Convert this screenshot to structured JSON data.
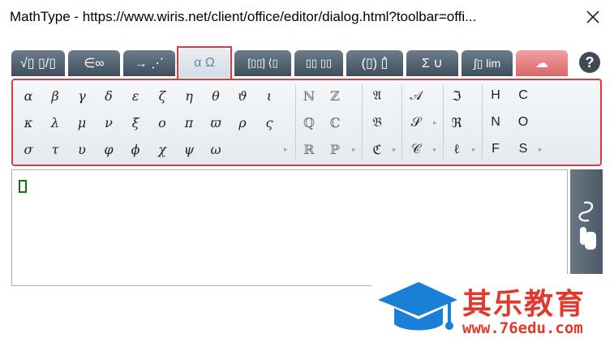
{
  "window": {
    "title": "MathType - https://www.wiris.net/client/office/editor/dialog.html?toolbar=offi..."
  },
  "tabs": [
    {
      "label": "√▯ ▯/▯",
      "name": "general"
    },
    {
      "label": "∈∞",
      "name": "symbols"
    },
    {
      "label": "→ ⋰",
      "name": "arrows"
    },
    {
      "label": "α Ω",
      "name": "greek",
      "active": true
    },
    {
      "label": "[▯▯] ⟨▯",
      "name": "matrices"
    },
    {
      "label": "▯▯ ▯▯",
      "name": "scripts"
    },
    {
      "label": "(▯) ▯̂",
      "name": "brackets"
    },
    {
      "label": "Σ ∪",
      "name": "big-operators"
    },
    {
      "label": "∫▯ lim",
      "name": "calculus"
    },
    {
      "label": "☁",
      "name": "contextual"
    }
  ],
  "help_label": "?",
  "palette": {
    "greek_rows": [
      [
        "α",
        "β",
        "γ",
        "δ",
        "ε",
        "ζ",
        "η",
        "θ",
        "ϑ",
        "ι"
      ],
      [
        "κ",
        "λ",
        "μ",
        "ν",
        "ξ",
        "ο",
        "π",
        "ϖ",
        "ρ",
        "ς"
      ],
      [
        "σ",
        "τ",
        "υ",
        "φ",
        "ϕ",
        "χ",
        "ψ",
        "ω"
      ]
    ],
    "doublestruck": [
      [
        "ℕ",
        "ℤ"
      ],
      [
        "ℚ",
        "ℂ"
      ],
      [
        "ℝ",
        "ℙ"
      ]
    ],
    "fraktur": [
      "𝔄",
      "𝔅",
      "ℭ"
    ],
    "script": [
      "𝒜",
      "𝒮",
      "𝒞"
    ],
    "fraktur2": [
      "ℑ",
      "ℜ",
      "ℓ"
    ],
    "latin": [
      [
        "H",
        "C"
      ],
      [
        "N",
        "O"
      ],
      [
        "F",
        "S"
      ]
    ],
    "more_glyph": "▸"
  },
  "editor": {
    "placeholder_glyph": ""
  },
  "watermark": {
    "brand": "其乐教育",
    "url": "www.76edu.com",
    "brand_color": "#e03a2f",
    "cap_color": "#1a7fd6"
  }
}
